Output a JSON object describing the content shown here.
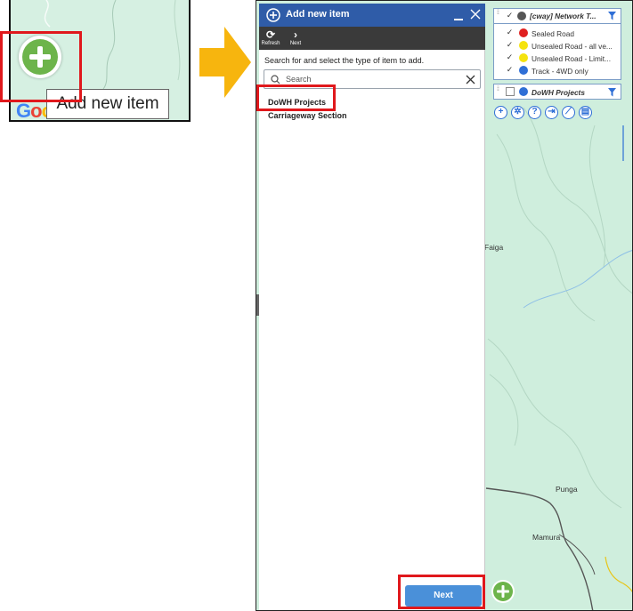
{
  "inset": {
    "add_button_icon": "plus-circle-icon",
    "tooltip": "Add new item",
    "brand_partial": "Goo",
    "highlight_color": "#e0181c"
  },
  "arrow": {
    "icon": "arrow-right-icon",
    "color": "#f7b50e"
  },
  "panel": {
    "title": "Add new item",
    "header_color": "#2f5ca8",
    "toolbar": {
      "refresh_label": "Refresh",
      "next_label": "Next"
    },
    "instructions": "Search for and select the type of item to add.",
    "search": {
      "placeholder": "Search",
      "value": ""
    },
    "items": [
      {
        "label": "DoWH Projects"
      },
      {
        "label": "Carriageway Section"
      }
    ],
    "next_button": "Next",
    "accent_color": "#4a90d9"
  },
  "layers": {
    "group_title": "[cway] Network T...",
    "group_color": "#555555",
    "items": [
      {
        "label": "Sealed Road",
        "color": "#e02020"
      },
      {
        "label": "Unsealed Road - all ve...",
        "color": "#f5e30e"
      },
      {
        "label": "Unsealed Road - Limit...",
        "color": "#f5e30e"
      },
      {
        "label": "Track - 4WD only",
        "color": "#2f6fd6"
      }
    ],
    "dowh_title": "DoWH Projects",
    "dowh_color": "#2f6fd6"
  },
  "map": {
    "labels": [
      "Faiga",
      "Punga",
      "Mamura"
    ],
    "tools": [
      "add-icon",
      "settings-icon",
      "help-icon",
      "sign-in-icon",
      "measure-icon",
      "print-icon"
    ]
  }
}
